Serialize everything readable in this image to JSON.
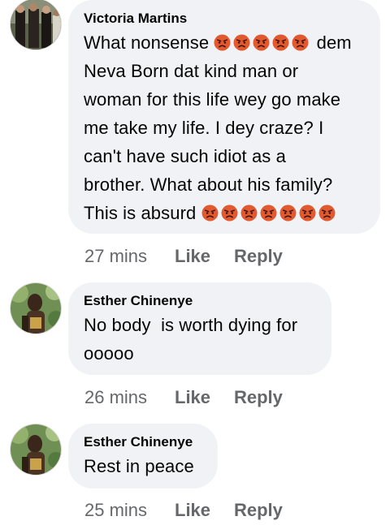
{
  "comments": [
    {
      "author": "Victoria Martins",
      "lines": [
        {
          "text": "What nonsense ",
          "emojis": 5,
          "after": " dem"
        },
        {
          "text": "Neva Born dat kind man or"
        },
        {
          "text": "woman for this life wey go make"
        },
        {
          "text": "me take my life. I dey craze? I"
        },
        {
          "text": "can't have such idiot as a"
        },
        {
          "text": "brother. What about his family?"
        },
        {
          "text": "This is absurd ",
          "emojis": 7
        }
      ],
      "time": "27 mins",
      "like": "Like",
      "reply": "Reply"
    },
    {
      "author": "Esther Chinenye",
      "lines": [
        {
          "text": "No body  is worth dying for"
        },
        {
          "text": "ooooo"
        }
      ],
      "time": "26 mins",
      "like": "Like",
      "reply": "Reply"
    },
    {
      "author": "Esther Chinenye",
      "lines": [
        {
          "text": "Rest in peace"
        }
      ],
      "time": "25 mins",
      "like": "Like",
      "reply": "Reply"
    }
  ],
  "emoji_icon": "angry-face-icon",
  "colors": {
    "bubble": "#f0f2f5",
    "meta": "#65676b",
    "emoji": "#e2592f"
  }
}
